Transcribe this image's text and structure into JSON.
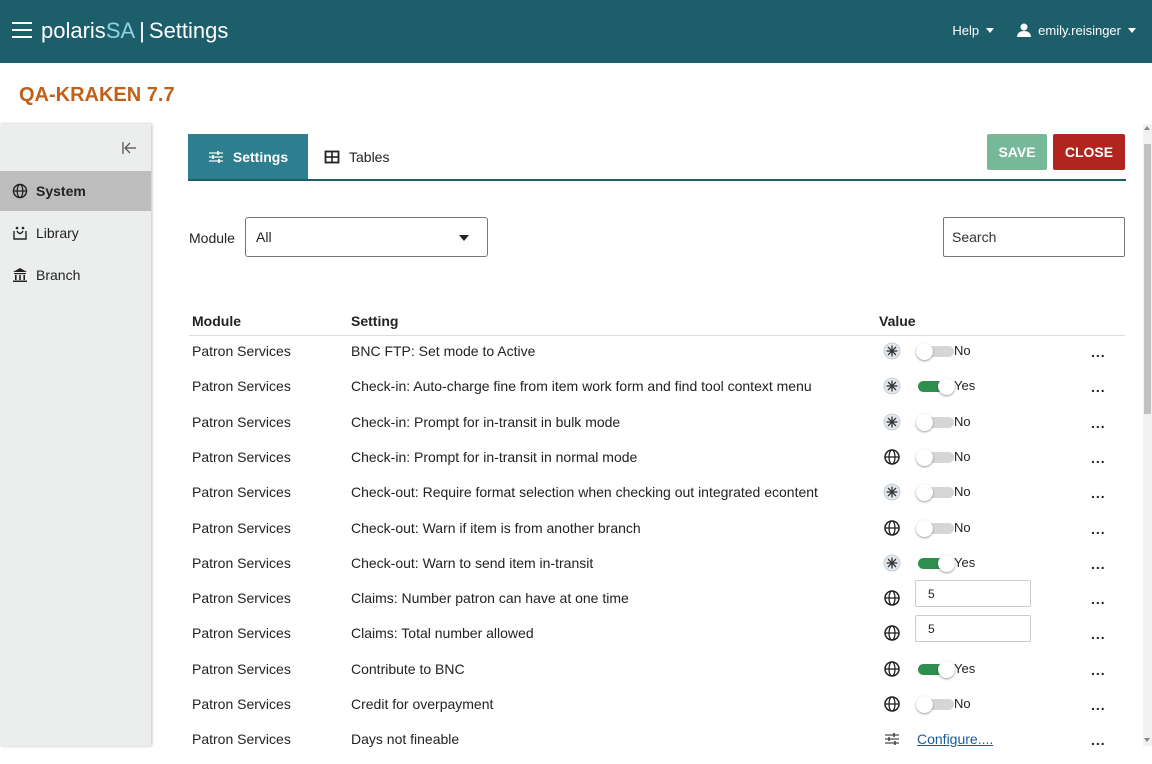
{
  "header": {
    "brand_part1": "polaris",
    "brand_part2": "SA",
    "separator": "|",
    "page_title": "Settings",
    "help_label": "Help",
    "user_name": "emily.reisinger"
  },
  "instance_title": "QA-KRAKEN 7.7",
  "sidebar": {
    "items": [
      {
        "label": "System",
        "icon": "globe-icon",
        "active": true
      },
      {
        "label": "Library",
        "icon": "library-icon",
        "active": false
      },
      {
        "label": "Branch",
        "icon": "branch-icon",
        "active": false
      }
    ]
  },
  "tabs": [
    {
      "label": "Settings",
      "icon": "sliders-icon",
      "active": true
    },
    {
      "label": "Tables",
      "icon": "table-icon",
      "active": false
    }
  ],
  "actions": {
    "save_label": "SAVE",
    "close_label": "CLOSE"
  },
  "filters": {
    "module_label": "Module",
    "module_selected": "All",
    "search_placeholder": "Search"
  },
  "table": {
    "headers": {
      "module": "Module",
      "setting": "Setting",
      "value": "Value"
    },
    "more_label": "...",
    "rows": [
      {
        "module": "Patron Services",
        "setting": "BNC FTP: Set mode to Active",
        "icon": "hub-icon",
        "type": "toggle",
        "on": false,
        "value": "No"
      },
      {
        "module": "Patron Services",
        "setting": "Check-in: Auto-charge fine from item work form and find tool context menu",
        "icon": "hub-icon",
        "type": "toggle",
        "on": true,
        "value": "Yes"
      },
      {
        "module": "Patron Services",
        "setting": "Check-in: Prompt for in-transit in bulk mode",
        "icon": "hub-icon",
        "type": "toggle",
        "on": false,
        "value": "No"
      },
      {
        "module": "Patron Services",
        "setting": "Check-in: Prompt for in-transit in normal mode",
        "icon": "globe-icon",
        "type": "toggle",
        "on": false,
        "value": "No"
      },
      {
        "module": "Patron Services",
        "setting": "Check-out: Require format selection when checking out integrated econtent",
        "icon": "hub-icon",
        "type": "toggle",
        "on": false,
        "value": "No"
      },
      {
        "module": "Patron Services",
        "setting": "Check-out: Warn if item is from another branch",
        "icon": "globe-icon",
        "type": "toggle",
        "on": false,
        "value": "No"
      },
      {
        "module": "Patron Services",
        "setting": "Check-out: Warn to send item in-transit",
        "icon": "hub-icon",
        "type": "toggle",
        "on": true,
        "value": "Yes"
      },
      {
        "module": "Patron Services",
        "setting": "Claims: Number patron can have at one time",
        "icon": "globe-icon",
        "type": "number",
        "value": "5"
      },
      {
        "module": "Patron Services",
        "setting": "Claims: Total number allowed",
        "icon": "globe-icon",
        "type": "number",
        "value": "5"
      },
      {
        "module": "Patron Services",
        "setting": "Contribute to BNC",
        "icon": "globe-icon",
        "type": "toggle",
        "on": true,
        "value": "Yes"
      },
      {
        "module": "Patron Services",
        "setting": "Credit for overpayment",
        "icon": "globe-icon",
        "type": "toggle",
        "on": false,
        "value": "No"
      },
      {
        "module": "Patron Services",
        "setting": "Days not fineable",
        "icon": "sliders-icon",
        "type": "link",
        "value": "Configure...."
      }
    ]
  },
  "colors": {
    "header_bg": "#1d5e6b",
    "accent_orange": "#c0601a",
    "save_green": "#77b899",
    "close_red": "#b0261f",
    "toggle_on": "#2f8f4e"
  }
}
